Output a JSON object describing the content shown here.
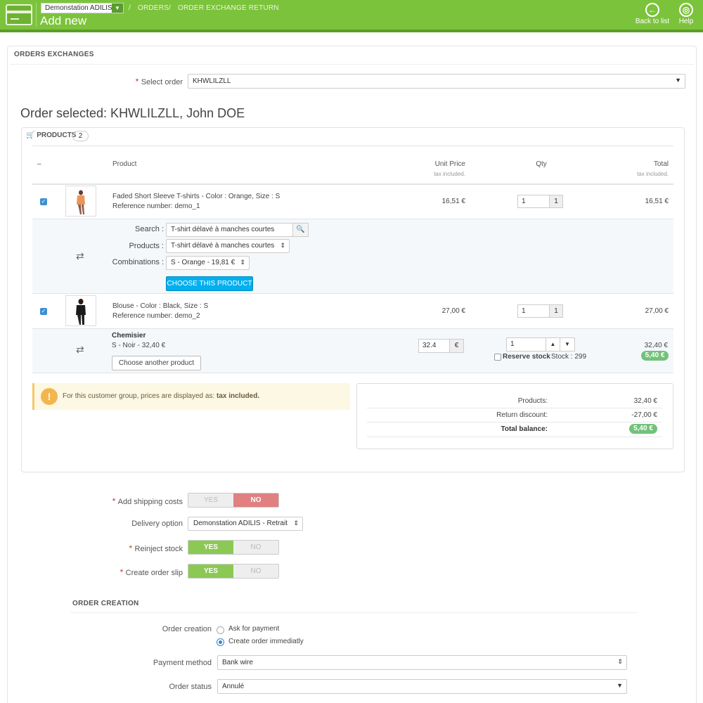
{
  "header": {
    "shop_select": "Demonstation ADILIS",
    "breadcrumb": [
      "ORDERS",
      "ORDER EXCHANGE RETURN"
    ],
    "title": "Add new",
    "back_label": "Back to list",
    "help_label": "Help"
  },
  "panel": {
    "title": "ORDERS EXCHANGES",
    "select_order_label": "Select order",
    "select_order_value": "KHWLILZLL",
    "order_heading": "Order selected: KHWLILZLL, John DOE"
  },
  "products": {
    "title": "PRODUCTS",
    "count": "2",
    "columns": {
      "dash": "–",
      "product": "Product",
      "unit_price": "Unit Price",
      "unit_price_sub": "tax included.",
      "qty": "Qty",
      "total": "Total",
      "total_sub": "tax included."
    },
    "rows": [
      {
        "name": "Faded Short Sleeve T-shirts - Color : Orange, Size : S",
        "reference": "Reference number: demo_1",
        "price": "16,51 €",
        "qty": "1",
        "qty_max": "1",
        "total": "16,51 €"
      },
      {
        "name": "Blouse - Color : Black, Size : S",
        "reference": "Reference number: demo_2",
        "price": "27,00 €",
        "qty": "1",
        "qty_max": "1",
        "total": "27,00 €"
      }
    ],
    "exchange1": {
      "search_label": "Search :",
      "search_value": "T-shirt délavé à manches courtes",
      "products_label": "Products :",
      "products_value": "T-shirt délavé à manches courtes",
      "combinations_label": "Combinations :",
      "combinations_value": "S - Orange - 19,81 €",
      "choose_button": "CHOOSE THIS PRODUCT"
    },
    "exchange2": {
      "name": "Chemisier",
      "detail": "S - Noir - 32,40 €",
      "button": "Choose another product",
      "price_value": "32.4",
      "currency": "€",
      "qty": "1",
      "reserve_label": "Reserve stock",
      "stock_text": "Stock : 299",
      "total": "32,40 €",
      "balance": "5,40 €"
    }
  },
  "alert": {
    "text": "For this customer group, prices are displayed as:",
    "strong": "tax included."
  },
  "totals": {
    "products_label": "Products:",
    "products_value": "32,40 €",
    "discount_label": "Return discount:",
    "discount_value": "-27,00 €",
    "balance_label": "Total balance:",
    "balance_value": "5,40 €"
  },
  "options": {
    "shipping_label": "Add shipping costs",
    "delivery_label": "Delivery option",
    "delivery_value": "Demonstation ADILIS - Retrait",
    "reinject_label": "Reinject stock",
    "slip_label": "Create order slip",
    "yes": "YES",
    "no": "NO"
  },
  "order_creation": {
    "title": "ORDER CREATION",
    "creation_label": "Order creation",
    "option_ask": "Ask for payment",
    "option_create": "Create order immediatly",
    "payment_label": "Payment method",
    "payment_value": "Bank wire",
    "status_label": "Order status",
    "status_value": "Annulé"
  },
  "colors": {
    "header_green": "#7cc33c",
    "primary_blue": "#00aff0",
    "badge_green": "#72c279",
    "switch_on": "#8bc954",
    "switch_no_red": "#e08080"
  }
}
